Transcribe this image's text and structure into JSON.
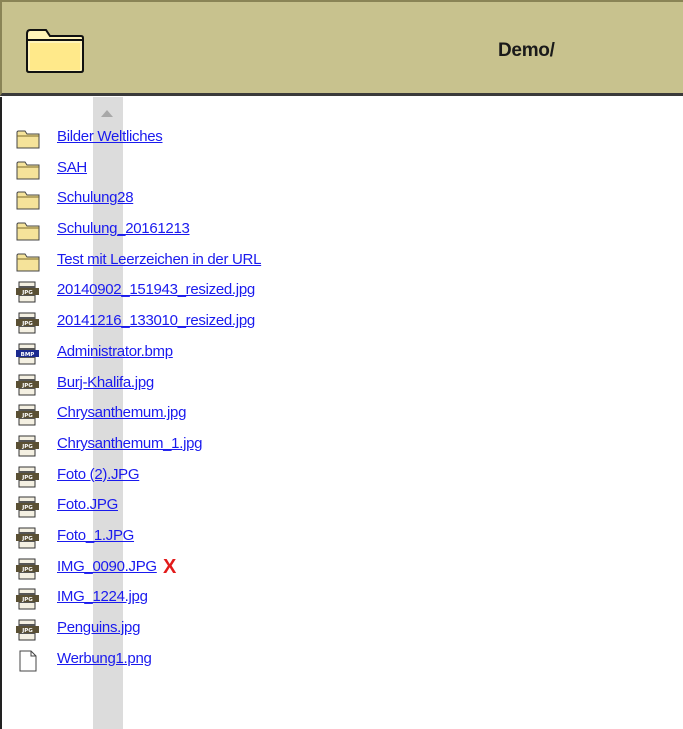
{
  "header": {
    "title": "Demo/"
  },
  "items": [
    {
      "name": "Bilder Weltliches",
      "type": "folder"
    },
    {
      "name": "SAH",
      "type": "folder"
    },
    {
      "name": "Schulung28",
      "type": "folder"
    },
    {
      "name": "Schulung_20161213",
      "type": "folder"
    },
    {
      "name": "Test mit Leerzeichen in der URL",
      "type": "folder"
    },
    {
      "name": "20140902_151943_resized.jpg",
      "type": "jpg",
      "badge": "JPG"
    },
    {
      "name": "20141216_133010_resized.jpg",
      "type": "jpg",
      "badge": "JPG"
    },
    {
      "name": "Administrator.bmp",
      "type": "bmp",
      "badge": "BMP"
    },
    {
      "name": "Burj-Khalifa.jpg",
      "type": "jpg",
      "badge": "JPG"
    },
    {
      "name": "Chrysanthemum.jpg",
      "type": "jpg",
      "badge": "JPG"
    },
    {
      "name": "Chrysanthemum_1.jpg",
      "type": "jpg",
      "badge": "JPG"
    },
    {
      "name": "Foto (2).JPG",
      "type": "jpg",
      "badge": "JPG"
    },
    {
      "name": "Foto.JPG",
      "type": "jpg",
      "badge": "JPG"
    },
    {
      "name": "Foto_1.JPG",
      "type": "jpg",
      "badge": "JPG"
    },
    {
      "name": "IMG_0090.JPG",
      "type": "jpg",
      "badge": "JPG",
      "delete_mark": "X"
    },
    {
      "name": "IMG_1224.jpg",
      "type": "jpg",
      "badge": "JPG"
    },
    {
      "name": "Penguins.jpg",
      "type": "jpg",
      "badge": "JPG"
    },
    {
      "name": "Werbung1.png",
      "type": "png"
    }
  ],
  "colors": {
    "header_bg": "#c8c28e",
    "link": "#1a1aee",
    "delete": "#e21b1b",
    "folder": "#f5e39a"
  },
  "icons": {
    "header": "open-folder-icon",
    "folder": "folder-icon",
    "jpg": "jpg-file-icon",
    "bmp": "bmp-file-icon",
    "png": "blank-file-icon"
  }
}
